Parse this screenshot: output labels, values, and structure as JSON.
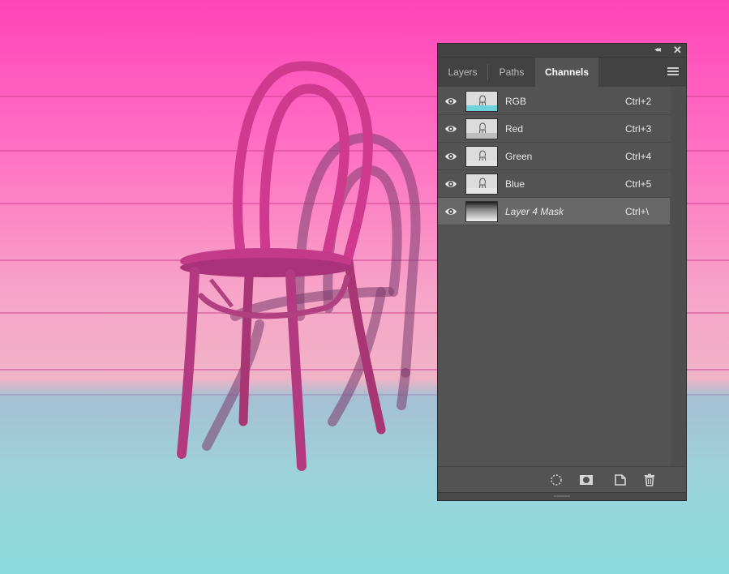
{
  "panel": {
    "tabs": [
      {
        "label": "Layers",
        "active": false
      },
      {
        "label": "Paths",
        "active": false
      },
      {
        "label": "Channels",
        "active": true
      }
    ],
    "channels": [
      {
        "name": "RGB",
        "shortcut": "Ctrl+2",
        "visible": true,
        "selected": false
      },
      {
        "name": "Red",
        "shortcut": "Ctrl+3",
        "visible": true,
        "selected": false
      },
      {
        "name": "Green",
        "shortcut": "Ctrl+4",
        "visible": true,
        "selected": false
      },
      {
        "name": "Blue",
        "shortcut": "Ctrl+5",
        "visible": true,
        "selected": false
      },
      {
        "name": "Layer 4 Mask",
        "shortcut": "Ctrl+\\",
        "visible": true,
        "selected": true
      }
    ],
    "bottom_icons": [
      "load-selection-icon",
      "save-selection-icon",
      "new-channel-icon",
      "delete-channel-icon"
    ]
  },
  "colors": {
    "panel_bg": "#535353",
    "selected_row": "#686868",
    "canvas_top": "#ff44b9",
    "canvas_floor": "#8adbdd",
    "chair": "#c33a86"
  }
}
